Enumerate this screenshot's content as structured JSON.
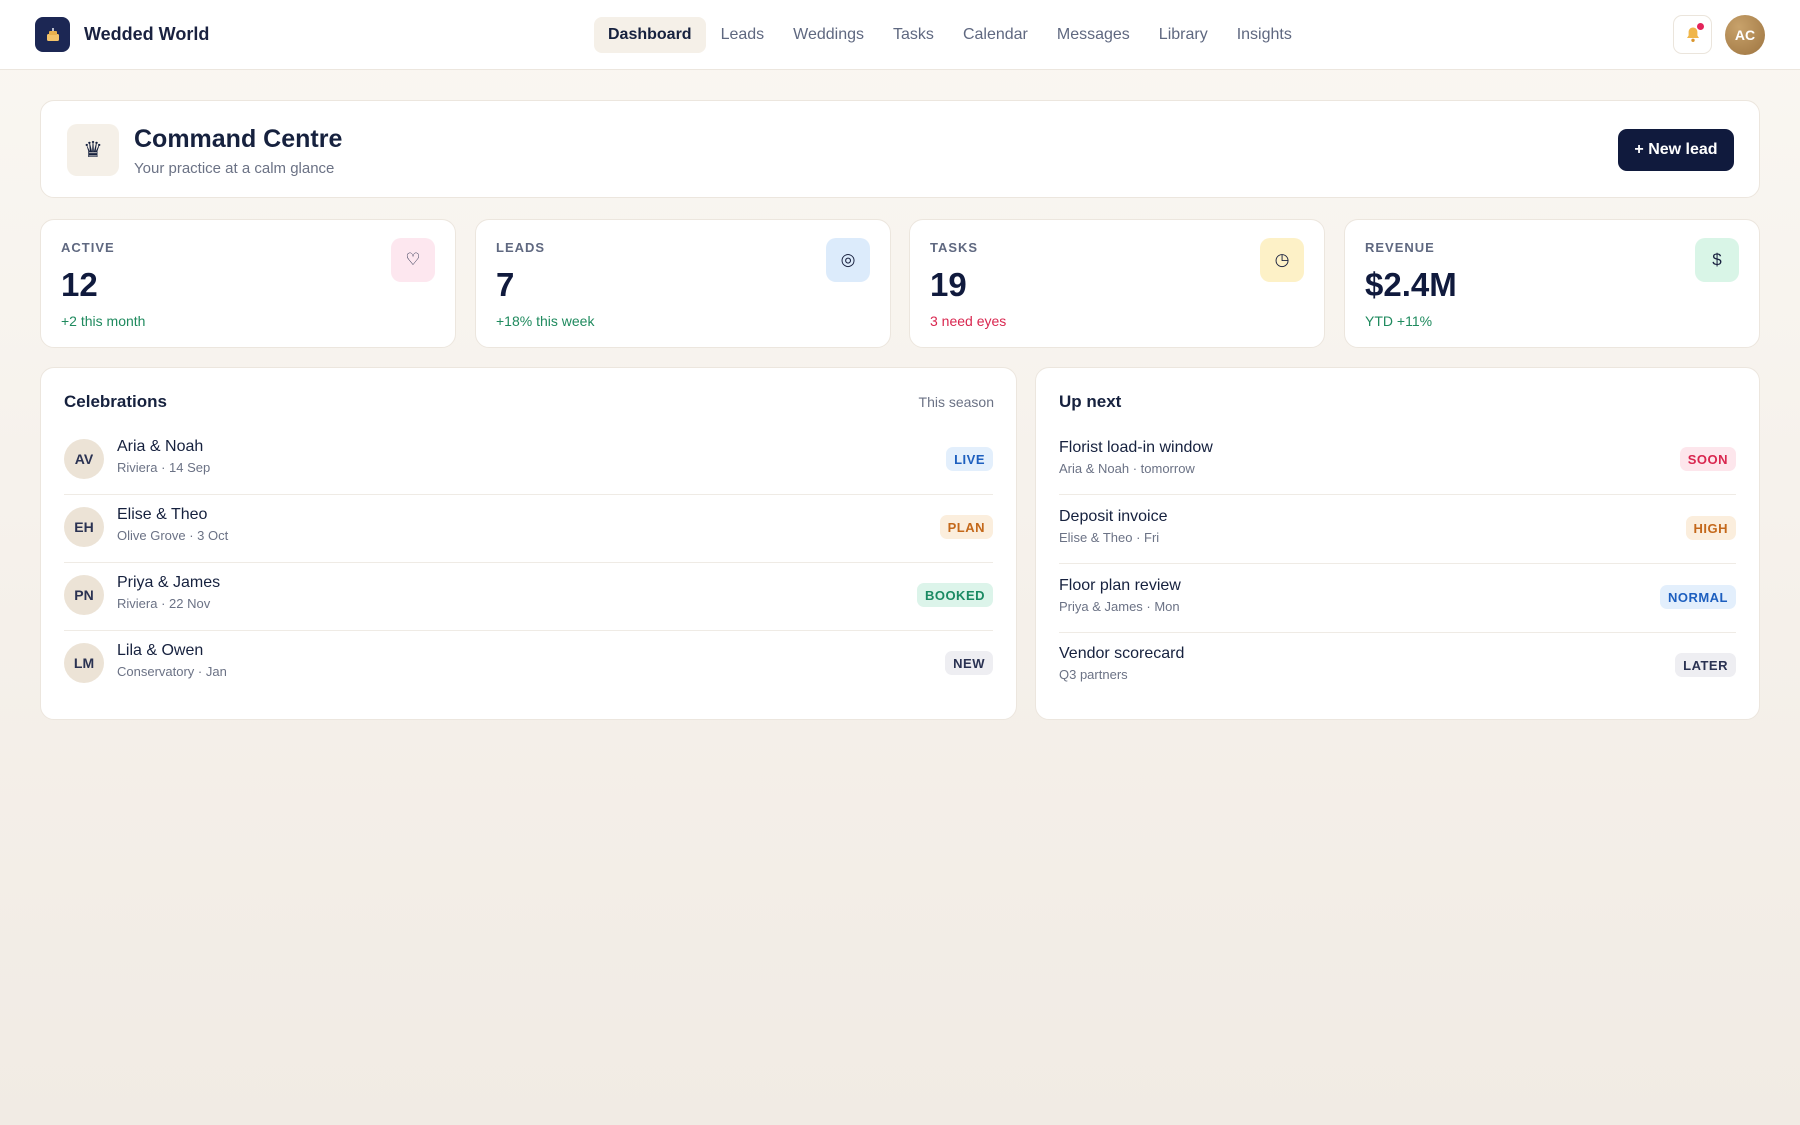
{
  "brand": {
    "name": "Wedded World",
    "logo_icon": "cake-icon"
  },
  "nav": {
    "items": [
      {
        "label": "Dashboard",
        "active": true
      },
      {
        "label": "Leads"
      },
      {
        "label": "Weddings"
      },
      {
        "label": "Tasks"
      },
      {
        "label": "Calendar"
      },
      {
        "label": "Messages"
      },
      {
        "label": "Library"
      },
      {
        "label": "Insights"
      }
    ]
  },
  "header": {
    "bell_icon": "bell-icon",
    "avatar_initials": "AC"
  },
  "hero": {
    "icon": "crown-icon",
    "title": "Command Centre",
    "subtitle": "Your practice at a calm glance",
    "cta_label": "+ New lead"
  },
  "stats": [
    {
      "label": "ACTIVE",
      "value": "12",
      "delta": "+2 this month",
      "delta_color": "#1f8a5e",
      "icon": "heart-icon",
      "icon_bg": "#fde7ef"
    },
    {
      "label": "LEADS",
      "value": "7",
      "delta": "+18% this week",
      "delta_color": "#1f8a5e",
      "icon": "target-icon",
      "icon_bg": "#dcebfb"
    },
    {
      "label": "TASKS",
      "value": "19",
      "delta": "3 need eyes",
      "delta_color": "#d9264f",
      "icon": "clock-icon",
      "icon_bg": "#fdf1c7"
    },
    {
      "label": "REVENUE",
      "value": "$2.4M",
      "delta": "YTD +11%",
      "delta_color": "#1f8a5e",
      "icon": "dollar-icon",
      "icon_bg": "#d9f5e7"
    }
  ],
  "celebrations": {
    "title": "Celebrations",
    "meta": "This season",
    "rows": [
      {
        "initials": "AV",
        "name": "Aria & Noah",
        "sub": "Riviera · 14 Sep",
        "badge": "LIVE",
        "badge_color": "#1d5fbf",
        "badge_bg": "#e3effc"
      },
      {
        "initials": "EH",
        "name": "Elise & Theo",
        "sub": "Olive Grove · 3 Oct",
        "badge": "PLAN",
        "badge_color": "#c4681a",
        "badge_bg": "#fbeedd"
      },
      {
        "initials": "PN",
        "name": "Priya & James",
        "sub": "Riviera · 22 Nov",
        "badge": "BOOKED",
        "badge_color": "#1a8a63",
        "badge_bg": "#dcf4ea"
      },
      {
        "initials": "LM",
        "name": "Lila & Owen",
        "sub": "Conservatory · Jan",
        "badge": "NEW",
        "badge_color": "#2a3252",
        "badge_bg": "#eeeef2"
      }
    ]
  },
  "up_next": {
    "title": "Up next",
    "rows": [
      {
        "name": "Florist load-in window",
        "sub": "Aria & Noah · tomorrow",
        "badge": "SOON",
        "badge_color": "#d9264f",
        "badge_bg": "#fde6ec"
      },
      {
        "name": "Deposit invoice",
        "sub": "Elise & Theo · Fri",
        "badge": "HIGH",
        "badge_color": "#c4681a",
        "badge_bg": "#fbeedd"
      },
      {
        "name": "Floor plan review",
        "sub": "Priya & James · Mon",
        "badge": "NORMAL",
        "badge_color": "#1d5fbf",
        "badge_bg": "#e3effc"
      },
      {
        "name": "Vendor scorecard",
        "sub": "Q3 partners",
        "badge": "LATER",
        "badge_color": "#2a3252",
        "badge_bg": "#eeeef2"
      }
    ]
  }
}
